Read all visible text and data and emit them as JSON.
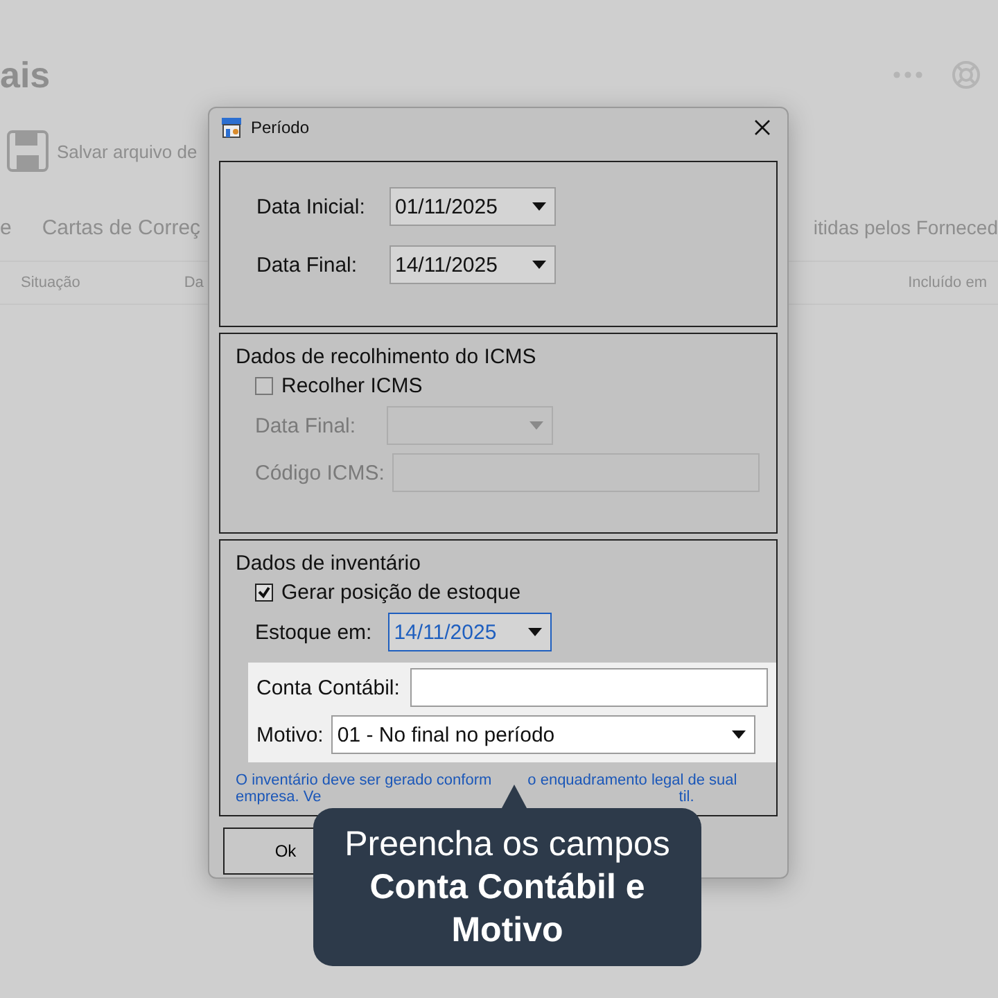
{
  "background_page": {
    "title": "ais",
    "toolbar": {
      "save_label": "Salvar arquivo de"
    },
    "tabs": [
      "e",
      "Cartas de Correç",
      "itidas pelos Forneced"
    ],
    "table": {
      "columns": [
        "Situação",
        "Da",
        "Incluído em"
      ]
    }
  },
  "dialog": {
    "title": "Período",
    "period": {
      "fields": [
        {
          "label": "Data Inicial:",
          "value": "01/11/2025"
        },
        {
          "label": "Data Final:",
          "value": "14/11/2025"
        }
      ]
    },
    "icms": {
      "heading": "Dados de recolhimento do ICMS",
      "checkbox": {
        "label": "Recolher ICMS",
        "checked": false
      },
      "date": {
        "label": "Data Final:",
        "disabled": true
      },
      "code": {
        "label": "Código ICMS:",
        "disabled": true
      }
    },
    "inventory": {
      "heading": "Dados de inventário",
      "checkbox": {
        "label": "Gerar posição de estoque",
        "checked": true
      },
      "stock_date": {
        "label": "Estoque em:",
        "value": "14/11/2025",
        "focused": true
      },
      "account": {
        "label": "Conta Contábil:"
      },
      "reason": {
        "label": "Motivo:",
        "value": "01 - No final no período"
      },
      "note_lines": [
        [
          "O inventário deve ser gerado conform",
          "o enquadramento legal de sual"
        ],
        [
          "empresa. Ve",
          "til."
        ]
      ]
    },
    "buttons": [
      "Ok"
    ]
  },
  "tooltip": "Preencha os campos **Conta Contábil e Motivo**"
}
